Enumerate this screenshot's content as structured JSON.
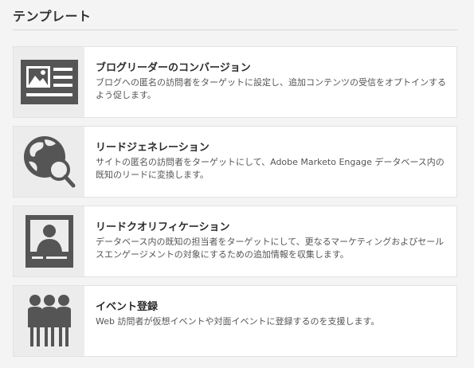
{
  "header": {
    "title": "テンプレート"
  },
  "templates": [
    {
      "title": "ブログリーダーのコンバージョン",
      "description": "ブログへの匿名の訪問者をターゲットに設定し、追加コンテンツの受信をオプトインするよう促します。",
      "icon": "id-card-icon"
    },
    {
      "title": "リードジェネレーション",
      "description": "サイトの匿名の訪問者をターゲットにして、Adobe Marketo Engage データベース内の既知のリードに変換します。",
      "icon": "globe-search-icon"
    },
    {
      "title": "リードクオリフィケーション",
      "description": "データベース内の既知の担当者をターゲットにして、更なるマーケティングおよびセールスエンゲージメントの対象にするための追加情報を収集します。",
      "icon": "profile-card-icon"
    },
    {
      "title": "イベント登録",
      "description": "Web 訪問者が仮想イベントや対面イベントに登録するのを支援します。",
      "icon": "people-group-icon"
    }
  ]
}
